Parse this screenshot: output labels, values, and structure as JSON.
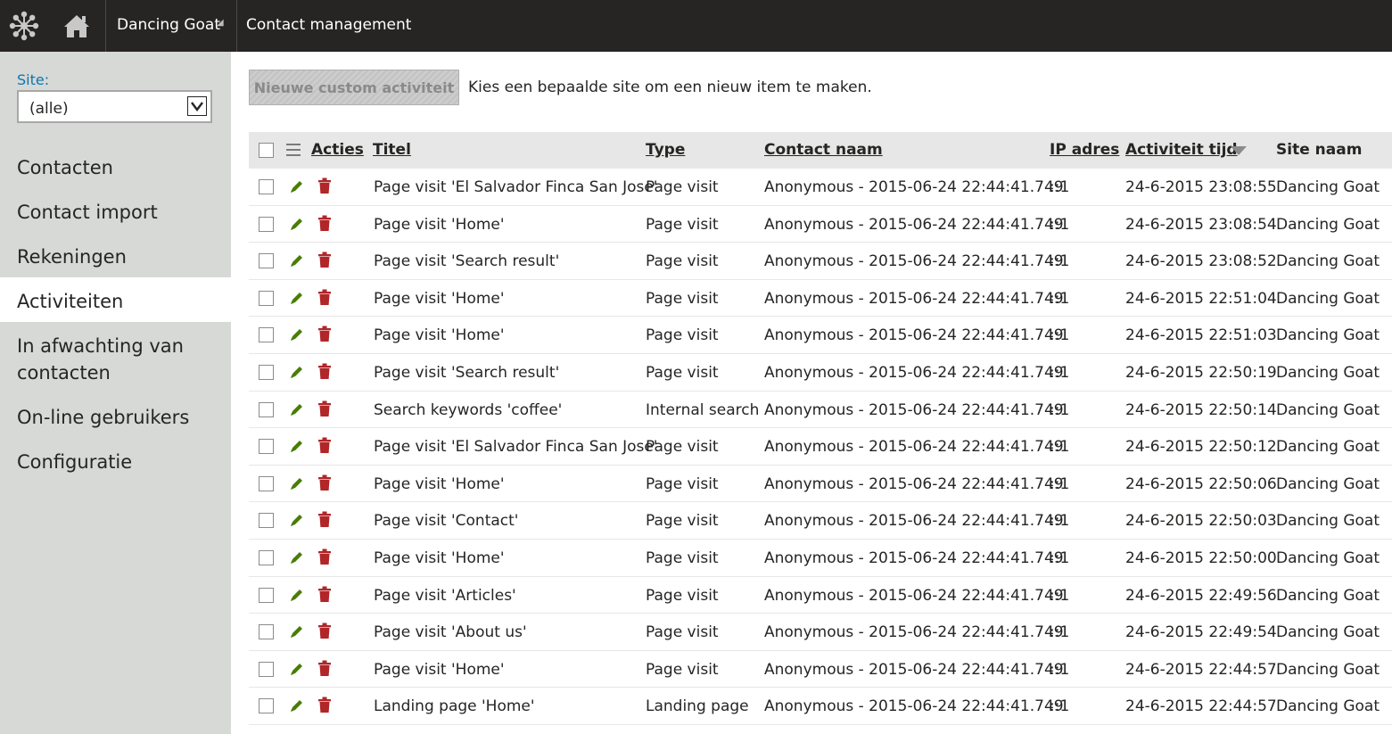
{
  "topbar": {
    "logo_icon": "kentico-logo-icon",
    "home_icon": "home-icon",
    "site_switcher": "Dancing Goat",
    "app_title": "Contact management"
  },
  "sidebar": {
    "site_label": "Site:",
    "site_select_value": "(alle)",
    "items": [
      {
        "label": "Contacten",
        "active": false
      },
      {
        "label": "Contact import",
        "active": false
      },
      {
        "label": "Rekeningen",
        "active": false
      },
      {
        "label": "Activiteiten",
        "active": true
      },
      {
        "label": "In afwachting van contacten",
        "active": false
      },
      {
        "label": "On-line gebruikers",
        "active": false
      },
      {
        "label": "Configuratie",
        "active": false
      }
    ]
  },
  "main": {
    "new_button": "Nieuwe custom activiteit",
    "hint": "Kies een bepaalde site om een nieuw item te maken."
  },
  "grid": {
    "columns": {
      "actions": "Acties",
      "title": "Titel",
      "type": "Type",
      "contact": "Contact naam",
      "ip": "IP adres",
      "time": "Activiteit tijd",
      "site": "Site naam"
    },
    "sorted_column": "time",
    "sort_direction": "desc",
    "rows": [
      {
        "title": "Page visit 'El Salvador Finca San Jose'",
        "type": "Page visit",
        "contact": "Anonymous - 2015-06-24 22:44:41.749",
        "ip": "::1",
        "time": "24-6-2015 23:08:55",
        "site": "Dancing Goat"
      },
      {
        "title": "Page visit 'Home'",
        "type": "Page visit",
        "contact": "Anonymous - 2015-06-24 22:44:41.749",
        "ip": "::1",
        "time": "24-6-2015 23:08:54",
        "site": "Dancing Goat"
      },
      {
        "title": "Page visit 'Search result'",
        "type": "Page visit",
        "contact": "Anonymous - 2015-06-24 22:44:41.749",
        "ip": "::1",
        "time": "24-6-2015 23:08:52",
        "site": "Dancing Goat"
      },
      {
        "title": "Page visit 'Home'",
        "type": "Page visit",
        "contact": "Anonymous - 2015-06-24 22:44:41.749",
        "ip": "::1",
        "time": "24-6-2015 22:51:04",
        "site": "Dancing Goat"
      },
      {
        "title": "Page visit 'Home'",
        "type": "Page visit",
        "contact": "Anonymous - 2015-06-24 22:44:41.749",
        "ip": "::1",
        "time": "24-6-2015 22:51:03",
        "site": "Dancing Goat"
      },
      {
        "title": "Page visit 'Search result'",
        "type": "Page visit",
        "contact": "Anonymous - 2015-06-24 22:44:41.749",
        "ip": "::1",
        "time": "24-6-2015 22:50:19",
        "site": "Dancing Goat"
      },
      {
        "title": "Search keywords 'coffee'",
        "type": "Internal search",
        "contact": "Anonymous - 2015-06-24 22:44:41.749",
        "ip": "::1",
        "time": "24-6-2015 22:50:14",
        "site": "Dancing Goat"
      },
      {
        "title": "Page visit 'El Salvador Finca San Jose'",
        "type": "Page visit",
        "contact": "Anonymous - 2015-06-24 22:44:41.749",
        "ip": "::1",
        "time": "24-6-2015 22:50:12",
        "site": "Dancing Goat"
      },
      {
        "title": "Page visit 'Home'",
        "type": "Page visit",
        "contact": "Anonymous - 2015-06-24 22:44:41.749",
        "ip": "::1",
        "time": "24-6-2015 22:50:06",
        "site": "Dancing Goat"
      },
      {
        "title": "Page visit 'Contact'",
        "type": "Page visit",
        "contact": "Anonymous - 2015-06-24 22:44:41.749",
        "ip": "::1",
        "time": "24-6-2015 22:50:03",
        "site": "Dancing Goat"
      },
      {
        "title": "Page visit 'Home'",
        "type": "Page visit",
        "contact": "Anonymous - 2015-06-24 22:44:41.749",
        "ip": "::1",
        "time": "24-6-2015 22:50:00",
        "site": "Dancing Goat"
      },
      {
        "title": "Page visit 'Articles'",
        "type": "Page visit",
        "contact": "Anonymous - 2015-06-24 22:44:41.749",
        "ip": "::1",
        "time": "24-6-2015 22:49:56",
        "site": "Dancing Goat"
      },
      {
        "title": "Page visit 'About us'",
        "type": "Page visit",
        "contact": "Anonymous - 2015-06-24 22:44:41.749",
        "ip": "::1",
        "time": "24-6-2015 22:49:54",
        "site": "Dancing Goat"
      },
      {
        "title": "Page visit 'Home'",
        "type": "Page visit",
        "contact": "Anonymous - 2015-06-24 22:44:41.749",
        "ip": "::1",
        "time": "24-6-2015 22:44:57",
        "site": "Dancing Goat"
      },
      {
        "title": "Landing page 'Home'",
        "type": "Landing page",
        "contact": "Anonymous - 2015-06-24 22:44:41.749",
        "ip": "::1",
        "time": "24-6-2015 22:44:57",
        "site": "Dancing Goat"
      }
    ]
  },
  "colors": {
    "topbar": "#262524",
    "sidebar": "#d6d9d6",
    "site_label": "#1175ae",
    "edit_icon": "#497d04",
    "delete_icon": "#b12628",
    "grid_header": "#e6e7e6"
  }
}
